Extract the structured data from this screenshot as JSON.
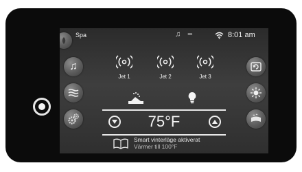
{
  "status_bar": {
    "app_name": "Spa",
    "time": "8:01 am",
    "icons": [
      "music-note-icon",
      "status-dots-icon",
      "wifi-icon"
    ]
  },
  "left_controls": [
    {
      "name": "music-button",
      "icon": "music-note-icon"
    },
    {
      "name": "waves-button",
      "icon": "water-waves-icon"
    },
    {
      "name": "settings-button",
      "icon": "gears-icon"
    }
  ],
  "right_controls": [
    {
      "name": "cycle-button",
      "icon": "cycle-icon"
    },
    {
      "name": "light-button",
      "icon": "sun-light-icon"
    },
    {
      "name": "blower-button",
      "icon": "blower-icon"
    }
  ],
  "jets": [
    {
      "label": "Jet 1"
    },
    {
      "label": "Jet 2"
    },
    {
      "label": "Jet 3"
    }
  ],
  "features": [
    {
      "name": "waterfall",
      "icon": "waterfall-icon"
    },
    {
      "name": "light",
      "icon": "light-bulb-icon"
    }
  ],
  "temperature": {
    "value": "75°F",
    "down_icon": "chevron-down-icon",
    "up_icon": "chevron-up-icon"
  },
  "info": {
    "icon": "book-icon",
    "line1": "Smart vinterläge aktiverat",
    "line2": "Värmer till 100°F"
  },
  "colors": {
    "screen_background": "#343434",
    "button_gray": "#6a6a6a",
    "text_light": "#f2f2f2",
    "bezel": "#0b0b0b"
  }
}
